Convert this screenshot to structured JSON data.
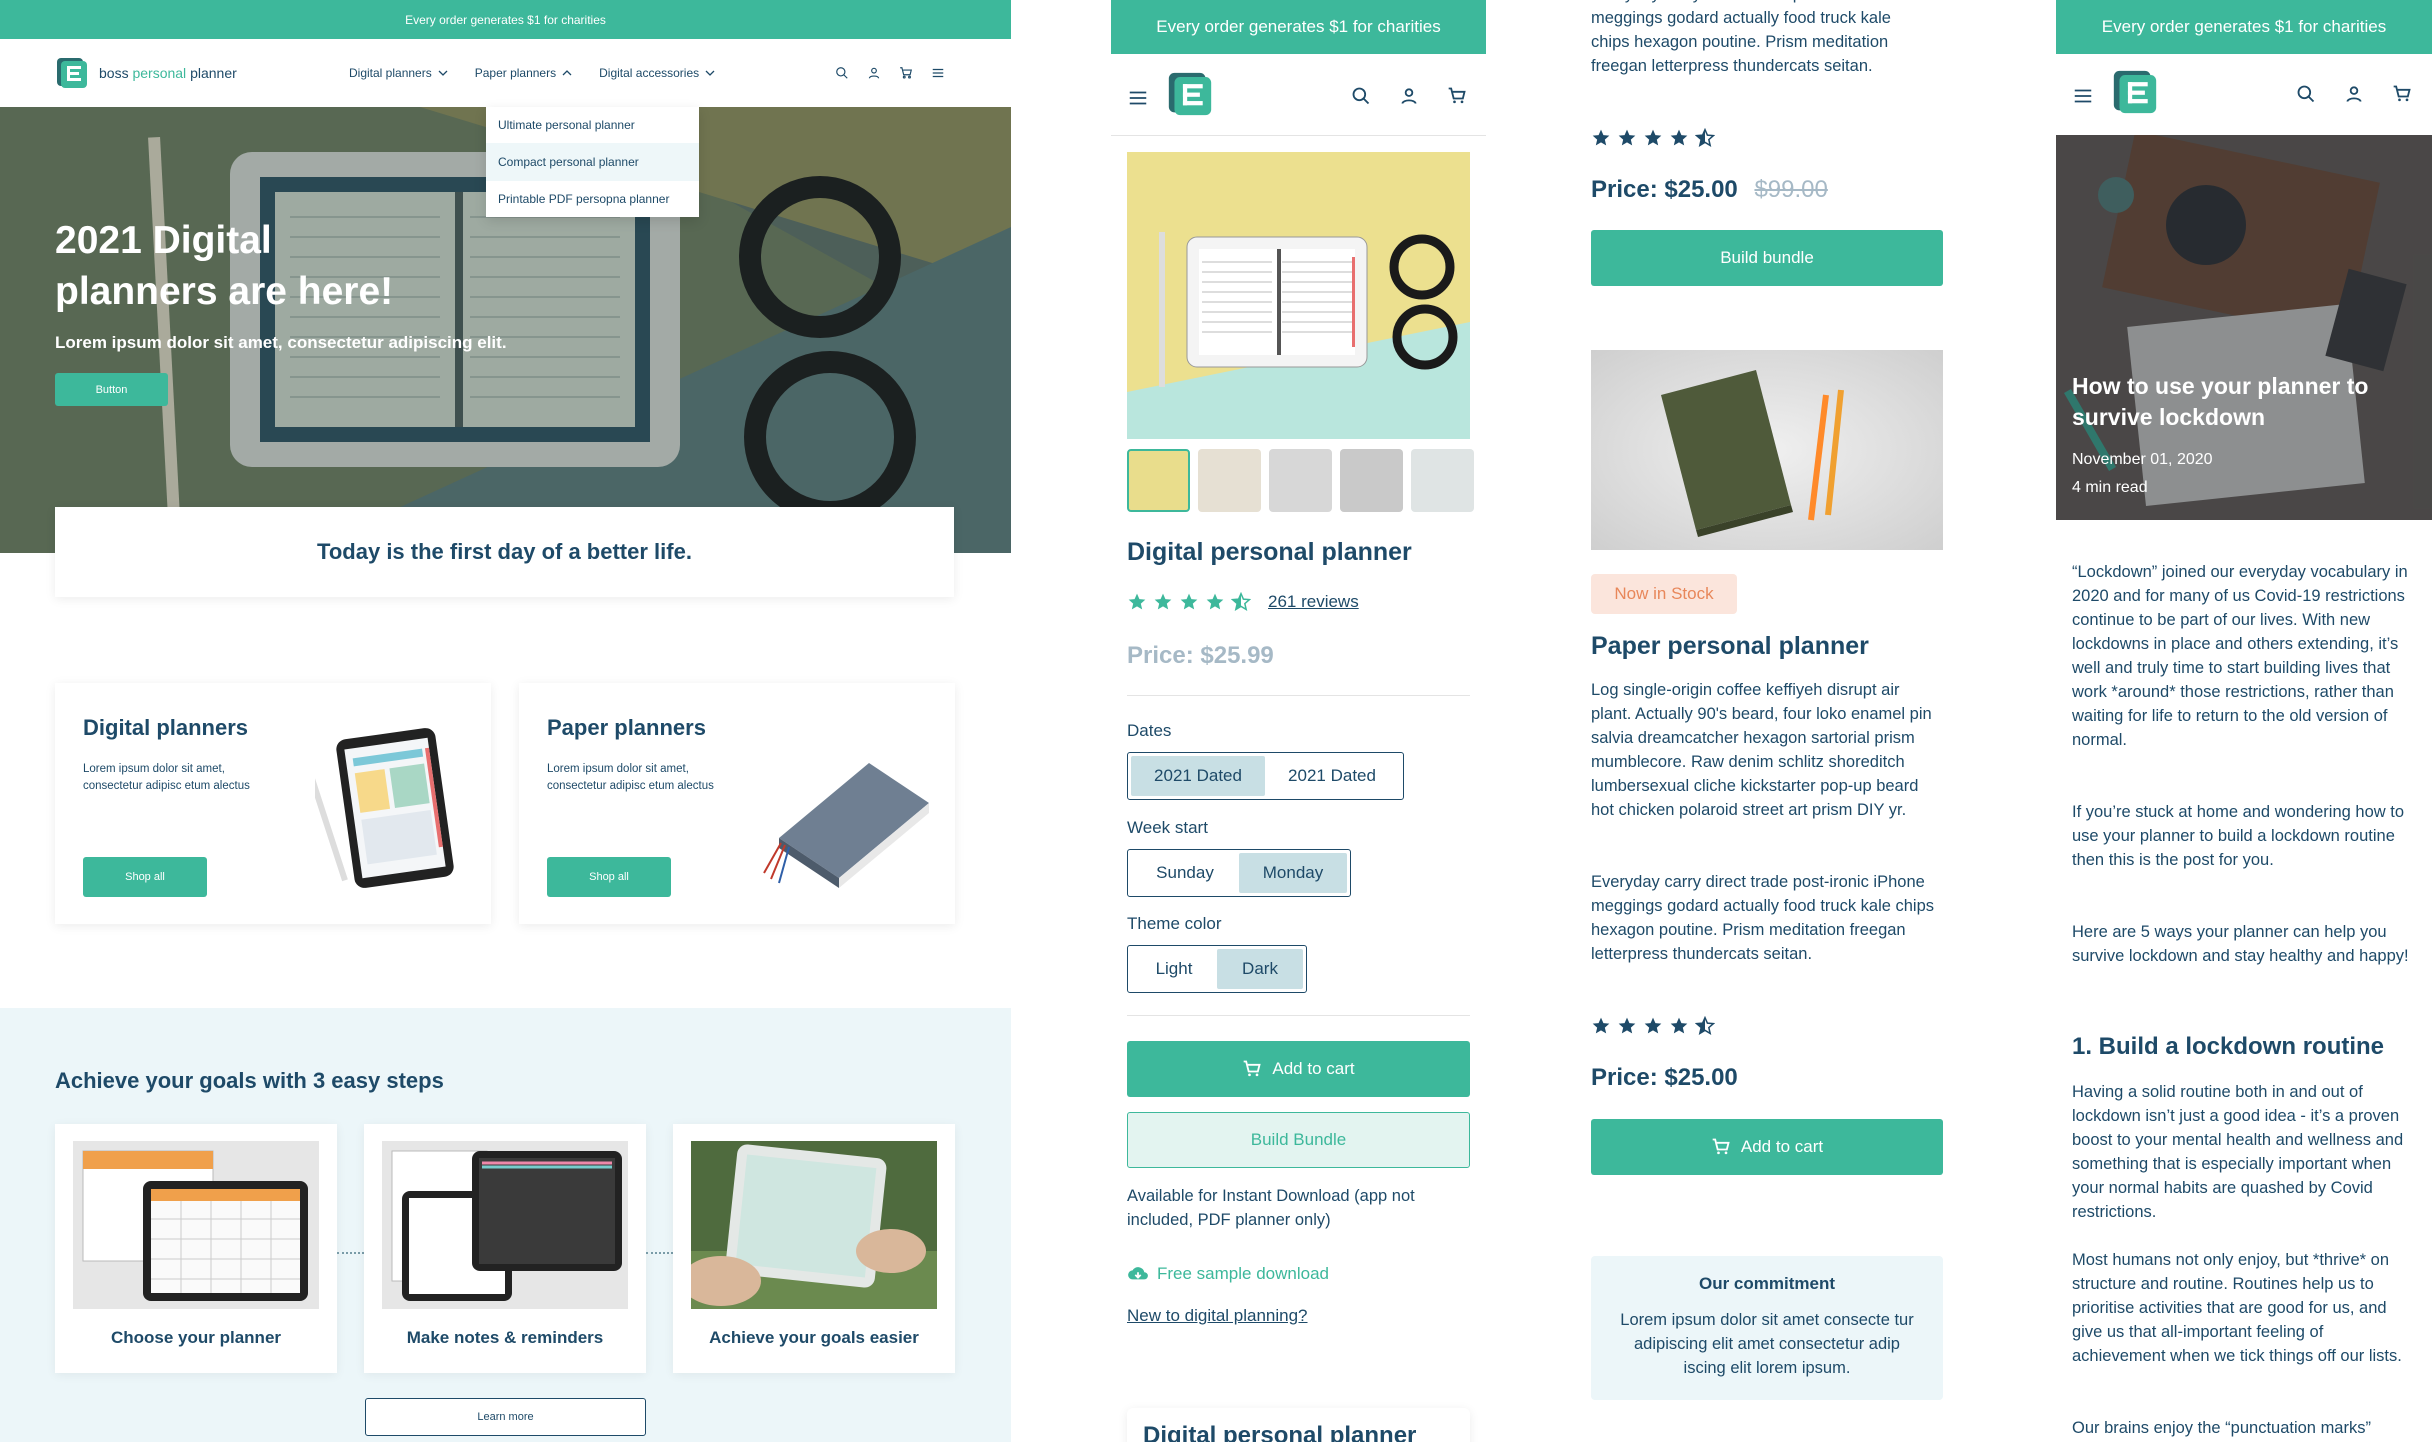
{
  "home": {
    "banner": "Every order generates $1 for charities",
    "brand": {
      "word1": "boss",
      "word2": "personal",
      "word3": "planner"
    },
    "nav": [
      {
        "label": "Digital planners",
        "icon": "chevron-down-icon"
      },
      {
        "label": "Paper planners",
        "icon": "chevron-up-icon"
      },
      {
        "label": "Digital accessories",
        "icon": "chevron-down-icon"
      }
    ],
    "dropdown": [
      "Ultimate personal planner",
      "Compact personal planner",
      "Printable PDF persopna planner"
    ],
    "hero": {
      "title_line1": "2021 Digital",
      "title_line2": "planners are here!",
      "subtitle": "Lorem ipsum dolor sit amet, consectetur adipiscing elit.",
      "button": "Button"
    },
    "tagline": "Today is the first day of a better life.",
    "categories": [
      {
        "title": "Digital planners",
        "desc": "Lorem ipsum dolor sit amet, consectetur adipisc etum alectus",
        "button": "Shop all"
      },
      {
        "title": "Paper planners",
        "desc": "Lorem ipsum dolor sit amet, consectetur adipisc etum alectus",
        "button": "Shop all"
      }
    ],
    "steps_title": "Achieve your goals with 3 easy steps",
    "steps": [
      "Choose your planner",
      "Make notes & reminders",
      "Achieve your goals easier"
    ],
    "learn_more": "Learn more"
  },
  "product": {
    "banner": "Every order generates $1 for charities",
    "title": "Digital personal planner",
    "rating": 4.5,
    "reviews": "261 reviews",
    "price": "Price: $25.99",
    "dates_label": "Dates",
    "dates_options": [
      "2021 Dated",
      "2021 Dated"
    ],
    "week_label": "Week start",
    "week_options": [
      "Sunday",
      "Monday"
    ],
    "theme_label": "Theme color",
    "theme_options": [
      "Light",
      "Dark"
    ],
    "add_to_cart": "Add to cart",
    "build_bundle": "Build Bundle",
    "availability": "Available for Instant Download (app not included, PDF planner only)",
    "free_sample": "Free sample download",
    "new_to_digital": "New to digital planning?",
    "next_title": "Digital personal planner"
  },
  "paper": {
    "top_text": "Everyday carry direct trade post-ironic iPhone meggings godard actually food truck kale chips hexagon poutine. Prism meditation freegan letterpress thundercats seitan.",
    "price1": "Price: $25.00",
    "old_price": "$99.00",
    "build_bundle": "Build bundle",
    "stock_badge": "Now in Stock",
    "title": "Paper personal planner",
    "desc1": "Log single-origin coffee keffiyeh disrupt air plant. Actually 90's beard, four loko enamel pin salvia dreamcatcher hexagon sartorial prism mumblecore. Raw denim schlitz shoreditch lumbersexual cliche kickstarter pop-up beard hot chicken polaroid street art prism DIY yr.",
    "desc2": "Everyday carry direct trade post-ironic iPhone meggings godard actually food truck kale chips hexagon poutine. Prism meditation freegan letterpress thundercats seitan.",
    "price2": "Price: $25.00",
    "add_to_cart": "Add to cart",
    "commitment_title": "Our commitment",
    "commitment_text": "Lorem ipsum dolor sit amet consecte tur adipiscing elit amet consectetur adip iscing elit lorem ipsum."
  },
  "blog": {
    "banner": "Every order generates $1 for charities",
    "title": "How to use your planner to survive lockdown",
    "date": "November 01, 2020",
    "read_time": "4 min read",
    "p1": "“Lockdown” joined our everyday vocabulary in 2020 and for many of us Covid-19 restrictions continue to be part of our lives. With new lockdowns in place and others extending, it’s well and truly time to start building lives that work *around* those restrictions, rather than waiting for life to return to the old version of normal.",
    "p2": "If you’re stuck at home and wondering how to use your planner to build a lockdown routine then this is the post for you.",
    "p3": "Here are 5 ways your planner can help you survive lockdown and stay healthy and happy!",
    "h2": "1. Build a lockdown routine",
    "p4": "Having a solid routine both in and out of lockdown isn’t just a good idea - it’s a proven boost to your mental health and wellness and something that is especially important when your normal habits are quashed by Covid restrictions.",
    "p5": "Most humans not only enjoy, but *thrive* on structure and routine. Routines help us to prioritise activities that are good for us, and give us that all-important feeling of achievement when we tick things off our lists.",
    "p6": "Our brains enjoy the “punctuation marks”"
  },
  "colors": {
    "teal": "#3db89b",
    "navy": "#1e4a68",
    "light_teal": "#e3f4f0",
    "badge": "#fbe5dc"
  }
}
